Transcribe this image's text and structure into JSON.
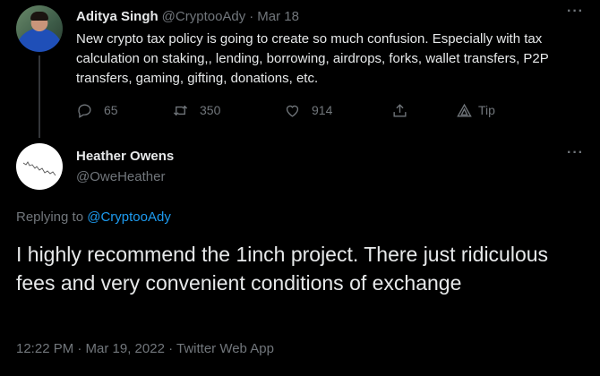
{
  "tweet": {
    "author_name": "Aditya Singh",
    "author_handle": "@CryptooAdy",
    "separator": "·",
    "date": "Mar 18",
    "text": "New crypto tax policy is going to create so much confusion. Especially with tax calculation on staking,, lending, borrowing, airdrops, forks, wallet transfers, P2P transfers, gaming, gifting, donations, etc.",
    "more": "···",
    "actions": {
      "replies": "65",
      "retweets": "350",
      "likes": "914",
      "tip": "Tip"
    },
    "icons": [
      "reply-icon",
      "retweet-icon",
      "like-icon",
      "share-icon",
      "tip-icon",
      "more-icon"
    ]
  },
  "reply": {
    "author_name": "Heather Owens",
    "author_handle": "@OweHeather",
    "more": "···",
    "replying_prefix": "Replying to",
    "replying_to": "@CryptooAdy",
    "text": "I highly recommend the 1inch project. There just ridiculous fees and very convenient conditions of exchange",
    "timestamp": "12:22 PM · Mar 19, 2022 · Twitter Web App"
  },
  "colors": {
    "background": "#000000",
    "text_primary": "#e7e9ea",
    "text_secondary": "#71767b",
    "link": "#1d9bf0",
    "divider": "#333639"
  }
}
